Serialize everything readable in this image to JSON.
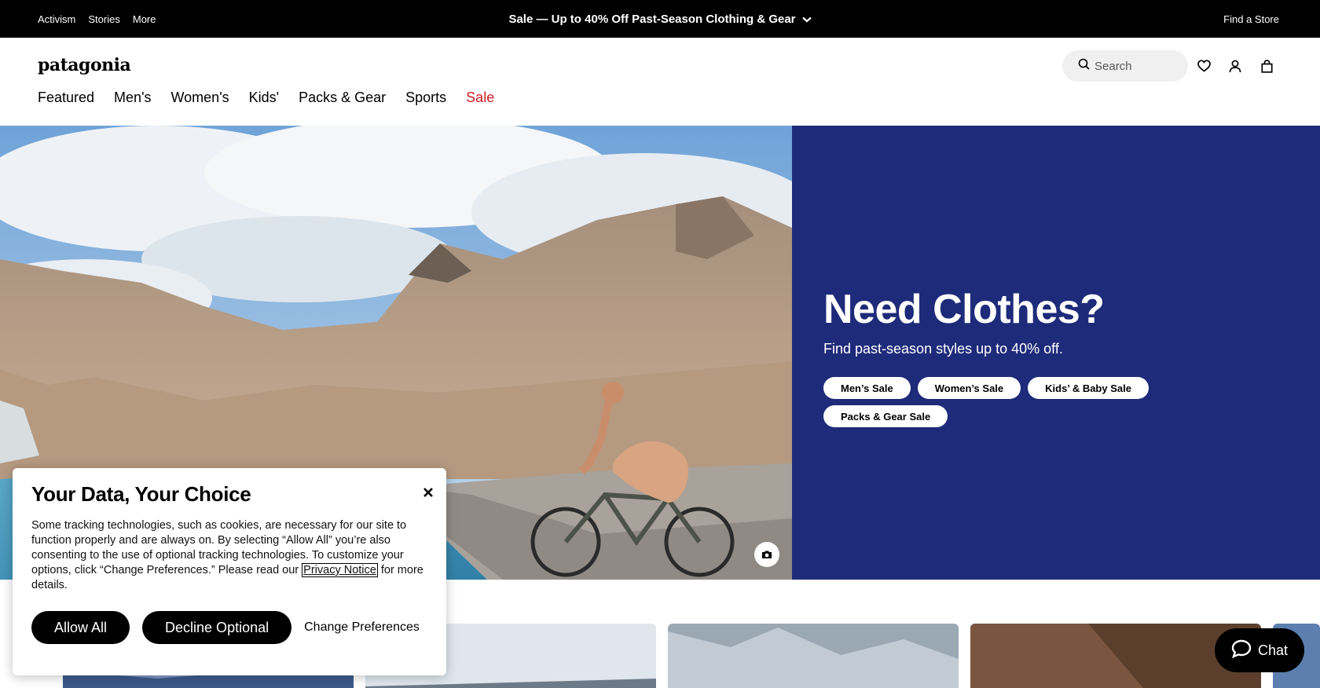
{
  "promo": {
    "links": [
      "Activism",
      "Stories",
      "More"
    ],
    "message": "Sale — Up to 40% Off Past-Season Clothing & Gear",
    "store_link": "Find a Store"
  },
  "header": {
    "logo": "patagonia",
    "search_placeholder": "Search",
    "icons": [
      "heart-icon",
      "account-icon",
      "bag-icon"
    ]
  },
  "nav": {
    "items": [
      "Featured",
      "Men's",
      "Women's",
      "Kids'",
      "Packs & Gear",
      "Sports",
      "Sale"
    ]
  },
  "hero": {
    "title": "Need Clothes?",
    "subtitle": "Find past-season styles up to 40% off.",
    "pills": [
      "Men’s Sale",
      "Women’s Sale",
      "Kids’ & Baby Sale",
      "Packs & Gear Sale"
    ],
    "panel_color": "#1e2b7a"
  },
  "cookie": {
    "title": "Your Data, Your Choice",
    "body_before": "Some tracking technologies, such as cookies, are necessary for our site to function properly and are always on. By selecting “Allow All” you’re also consenting to the use of optional tracking technologies. To customize your options, click “Change Preferences.” Please read our ",
    "privacy_link": "Privacy Notice",
    "body_after": " for more details.",
    "allow_all": "Allow All",
    "decline": "Decline Optional",
    "change_prefs": "Change Preferences"
  },
  "chat": {
    "label": "Chat"
  },
  "colors": {
    "sale_red": "#cc1e27",
    "brand_navy": "#1e2b7a"
  }
}
